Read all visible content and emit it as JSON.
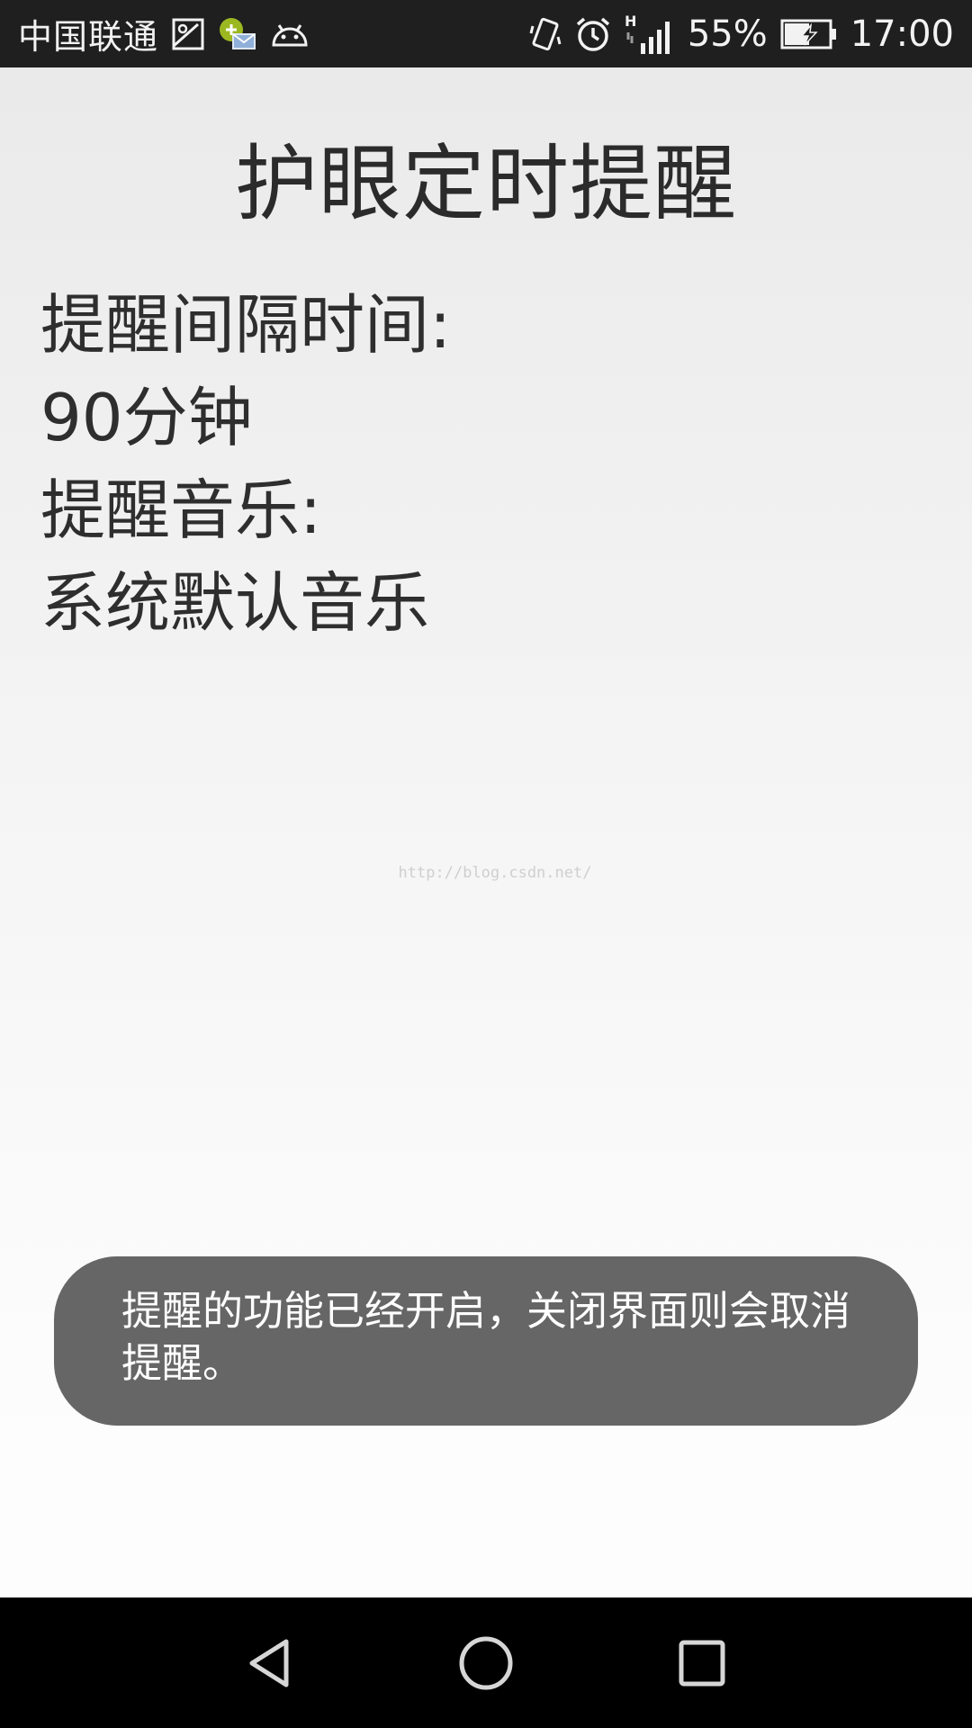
{
  "status_bar": {
    "carrier": "中国联通",
    "left_icons": [
      "gallery-icon",
      "message-notification-icon",
      "android-debug-icon"
    ],
    "right_icons": [
      "vibrate-icon",
      "alarm-icon",
      "signal-icon"
    ],
    "network_type": "H",
    "battery_percent": "55%",
    "time": "17:00"
  },
  "main": {
    "title": "护眼定时提醒",
    "interval_label": "提醒间隔时间:",
    "interval_value": "90分钟",
    "music_label": "提醒音乐:",
    "music_value": "系统默认音乐"
  },
  "watermark": "http://blog.csdn.net/",
  "toast": {
    "message": "提醒的功能已经开启，关闭界面则会取消提醒。"
  },
  "nav_bar": {
    "buttons": [
      "back-icon",
      "home-icon",
      "recents-icon"
    ]
  },
  "colors": {
    "status_bar_bg": "#1f1f1f",
    "toast_bg": "#666666",
    "nav_bar_bg": "#000000",
    "text": "#2e2e2e"
  }
}
